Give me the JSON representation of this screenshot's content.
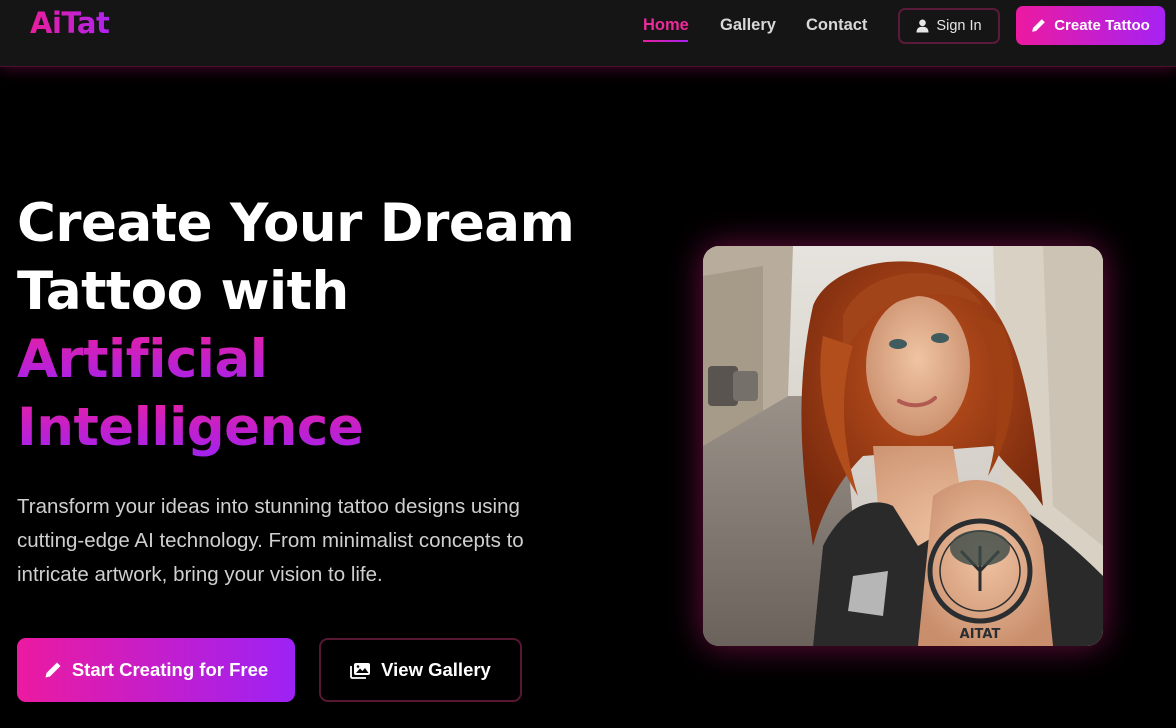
{
  "header": {
    "logo": "AiTat",
    "nav": {
      "home": "Home",
      "gallery": "Gallery",
      "contact": "Contact"
    },
    "sign_in": "Sign In",
    "create_tattoo": "Create Tattoo"
  },
  "hero": {
    "title_line1": "Create Your Dream",
    "title_line2": "Tattoo with",
    "title_highlight1": "Artificial",
    "title_highlight2": "Intelligence",
    "description": "Transform your ideas into stunning tattoo designs using cutting-edge AI technology. From minimalist concepts to intricate artwork, bring your vision to life.",
    "primary_cta": "Start Creating for Free",
    "secondary_cta": "View Gallery",
    "image_tattoo_text": "AITAT"
  },
  "icons": {
    "sign_in": "user-icon",
    "create": "pencil-icon",
    "gallery": "images-icon"
  },
  "colors": {
    "accent_pink": "#ec1aa0",
    "accent_purple": "#a622f3",
    "background": "#000000",
    "header_bg": "#151515"
  }
}
